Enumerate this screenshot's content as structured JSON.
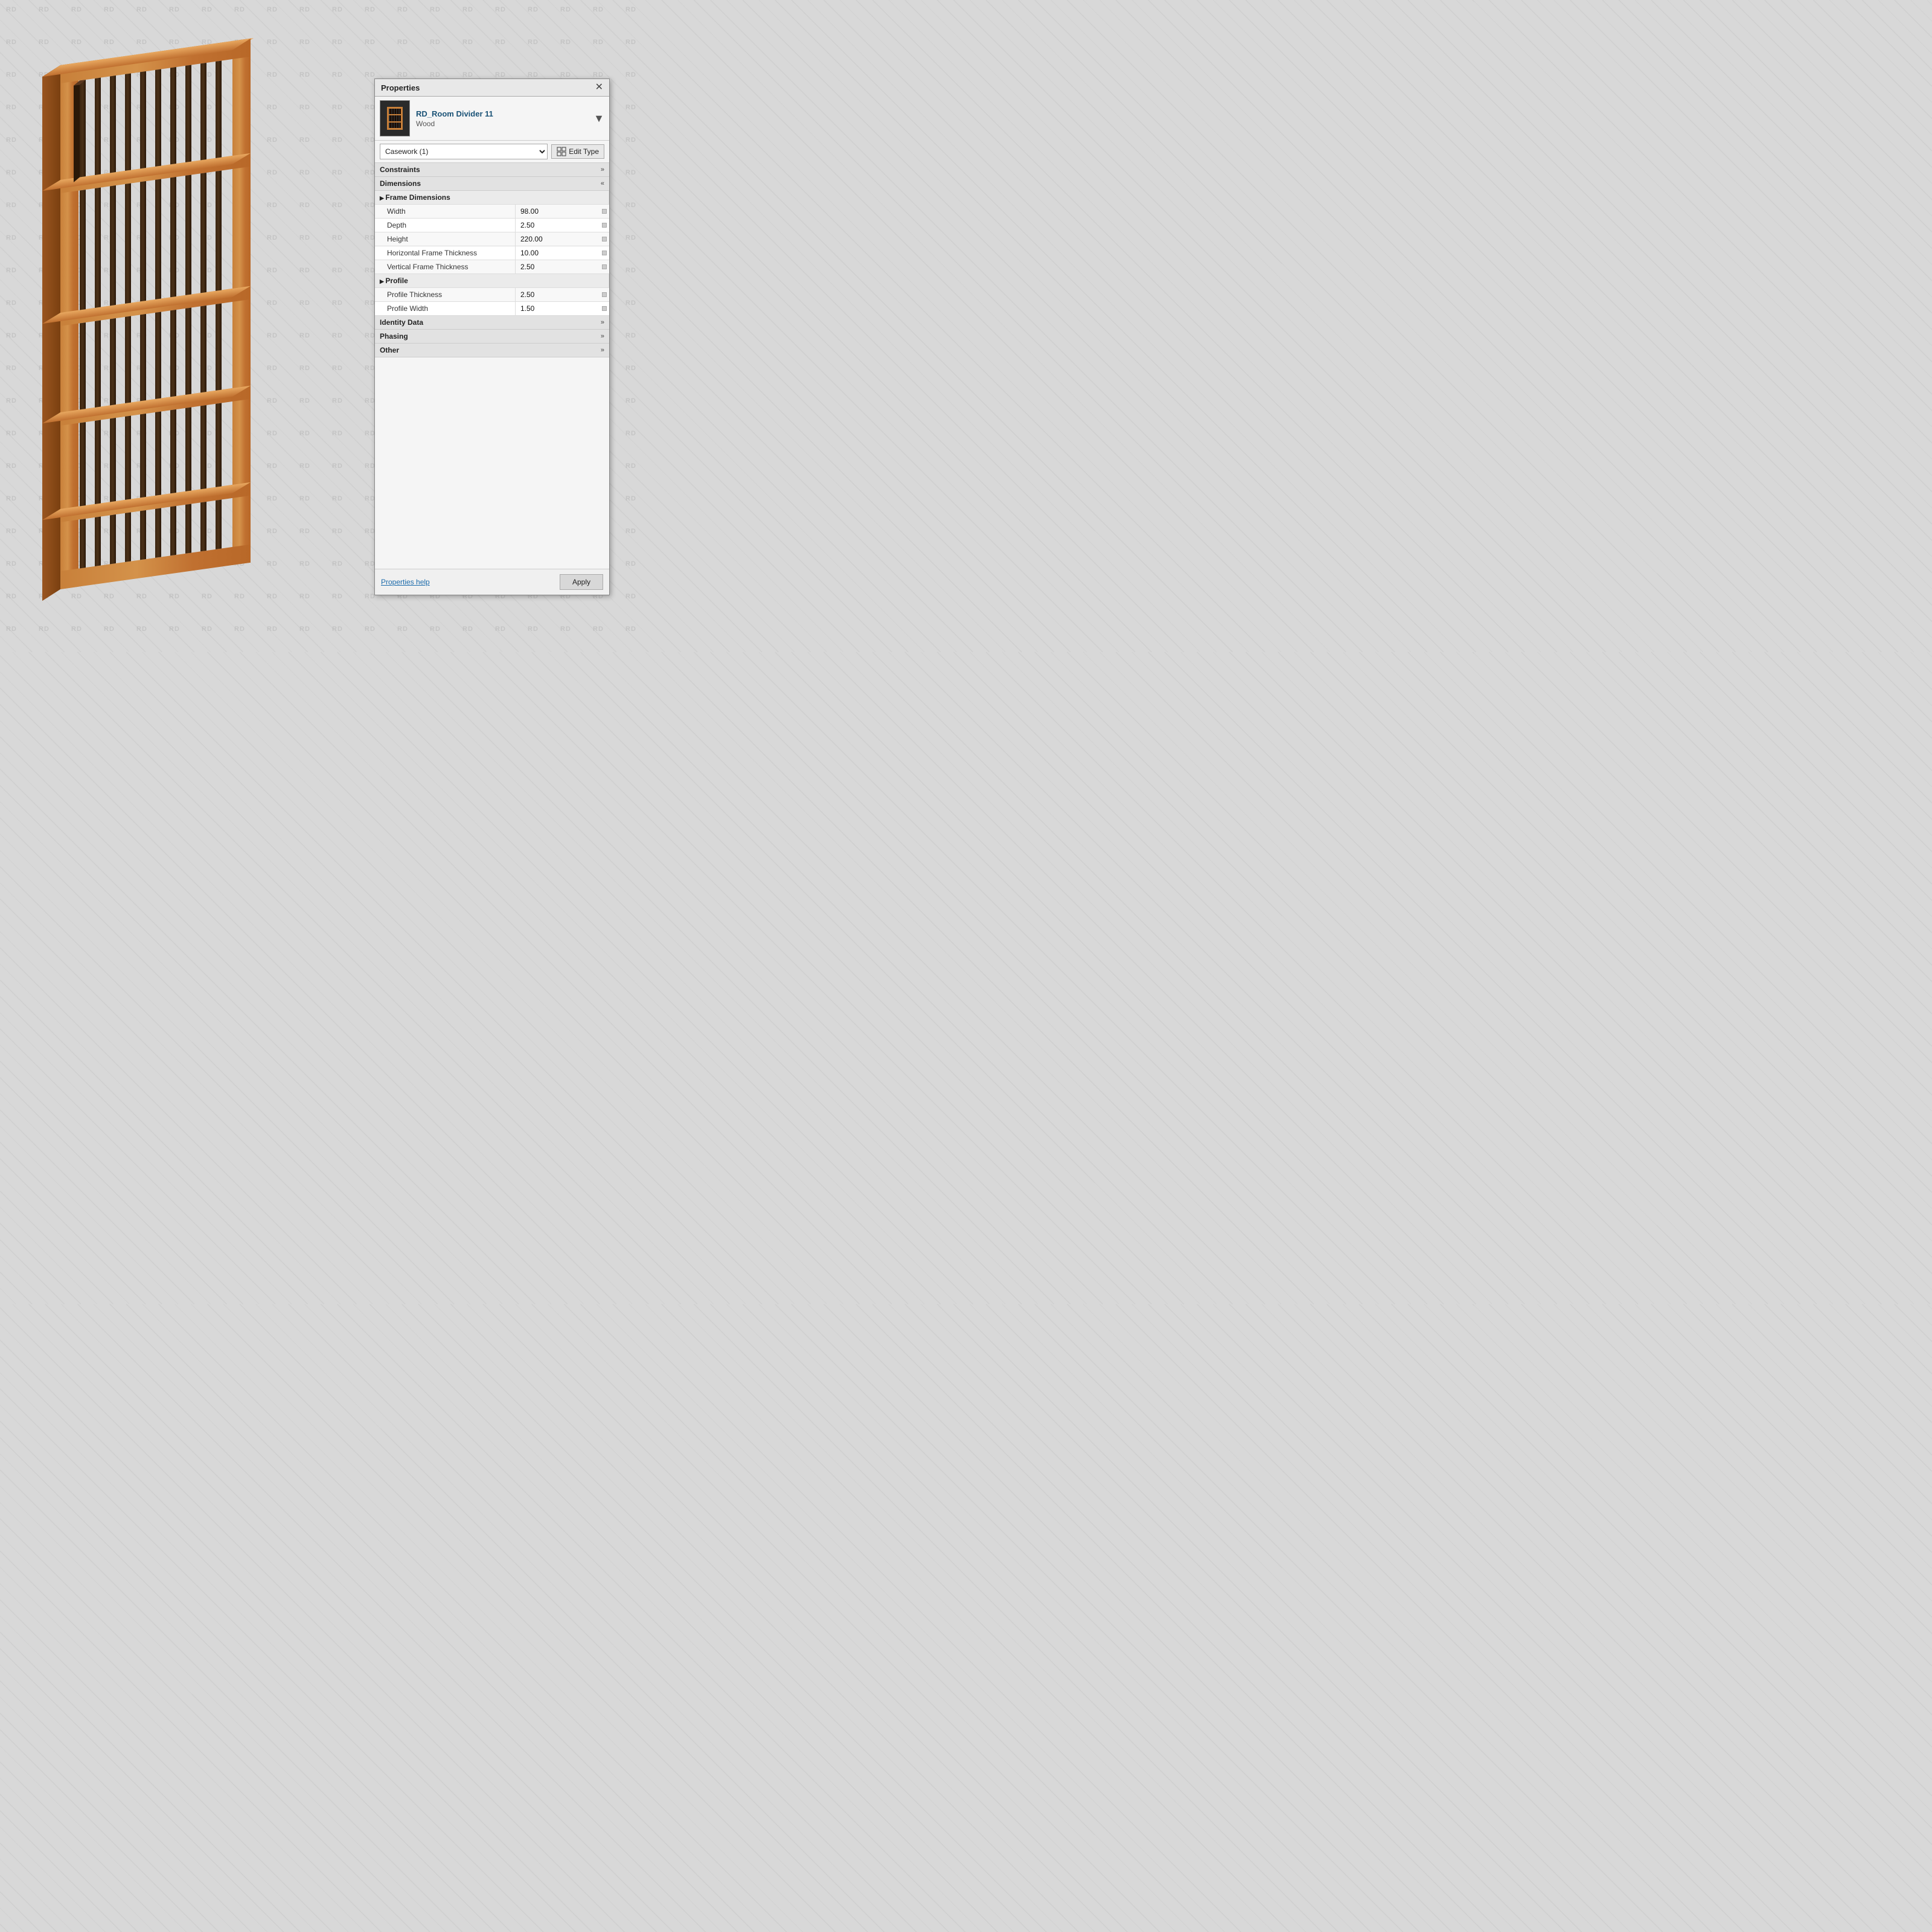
{
  "panel": {
    "title": "Properties",
    "close_label": "✕",
    "object_name": "RD_Room Divider 11",
    "object_sub": "Wood",
    "dropdown_value": "Casework (1)",
    "edit_type_label": "Edit Type",
    "sections": {
      "constraints": {
        "label": "Constraints",
        "collapsed": true
      },
      "dimensions": {
        "label": "Dimensions",
        "collapsed": false
      },
      "identity_data": {
        "label": "Identity Data",
        "collapsed": true
      },
      "phasing": {
        "label": "Phasing",
        "collapsed": true
      },
      "other": {
        "label": "Other",
        "collapsed": true
      }
    },
    "frame_dimensions_label": "Frame Dimensions",
    "properties": [
      {
        "name": "Width",
        "value": "98.00"
      },
      {
        "name": "Depth",
        "value": "2.50"
      },
      {
        "name": "Height",
        "value": "220.00"
      },
      {
        "name": "Horizontal Frame Thickness",
        "value": "10.00"
      },
      {
        "name": "Vertical Frame Thickness",
        "value": "2.50"
      }
    ],
    "profile_label": "Profile",
    "profile_properties": [
      {
        "name": "Profile Thickness",
        "value": "2.50"
      },
      {
        "name": "Profile Width",
        "value": "1.50"
      }
    ],
    "footer": {
      "help_label": "Properties help",
      "apply_label": "Apply"
    }
  },
  "watermark": {
    "text": "RD"
  },
  "viewport": {
    "background": "#d0c8c0"
  }
}
